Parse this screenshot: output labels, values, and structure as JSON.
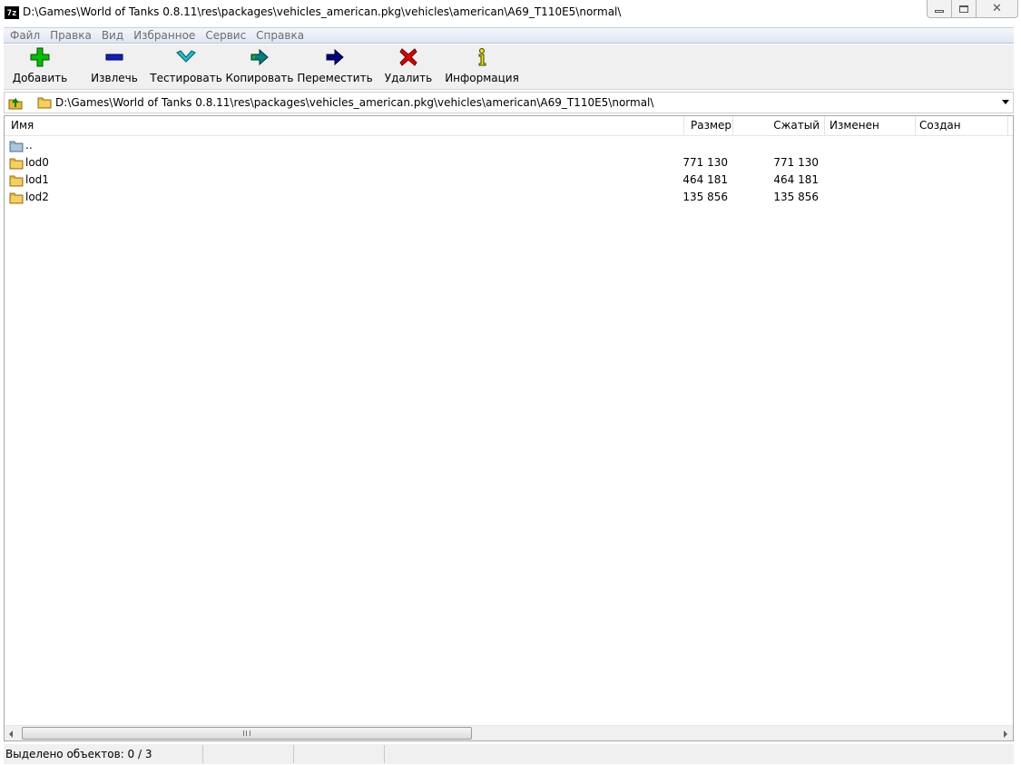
{
  "window": {
    "app_icon_text": "7z",
    "title": "D:\\Games\\World of Tanks 0.8.11\\res\\packages\\vehicles_american.pkg\\vehicles\\american\\A69_T110E5\\normal\\"
  },
  "menu": [
    "Файл",
    "Правка",
    "Вид",
    "Избранное",
    "Сервис",
    "Справка"
  ],
  "toolbar": {
    "add": "Добавить",
    "extract": "Извлечь",
    "test": "Тестировать",
    "copy": "Копировать",
    "move": "Переместить",
    "delete": "Удалить",
    "info": "Информация"
  },
  "address": {
    "path": "D:\\Games\\World of Tanks 0.8.11\\res\\packages\\vehicles_american.pkg\\vehicles\\american\\A69_T110E5\\normal\\"
  },
  "columns": {
    "name": "Имя",
    "size": "Размер",
    "packed": "Сжатый",
    "modified": "Изменен",
    "created": "Создан"
  },
  "rows": [
    {
      "name": "..",
      "size": "",
      "packed": "",
      "type": "parent"
    },
    {
      "name": "lod0",
      "size": "771 130",
      "packed": "771 130",
      "type": "folder"
    },
    {
      "name": "lod1",
      "size": "464 181",
      "packed": "464 181",
      "type": "folder"
    },
    {
      "name": "lod2",
      "size": "135 856",
      "packed": "135 856",
      "type": "folder"
    }
  ],
  "status": {
    "selected": "Выделено объектов: 0 / 3"
  },
  "colors": {
    "add_icon": "#00c000",
    "extract_icon": "#1020c0",
    "test_icon": "#20c0d0",
    "copy_icon": "#008080",
    "move_icon": "#000080",
    "delete_icon": "#e00000",
    "info_icon": "#e8e000",
    "folder": "#e8b830"
  }
}
